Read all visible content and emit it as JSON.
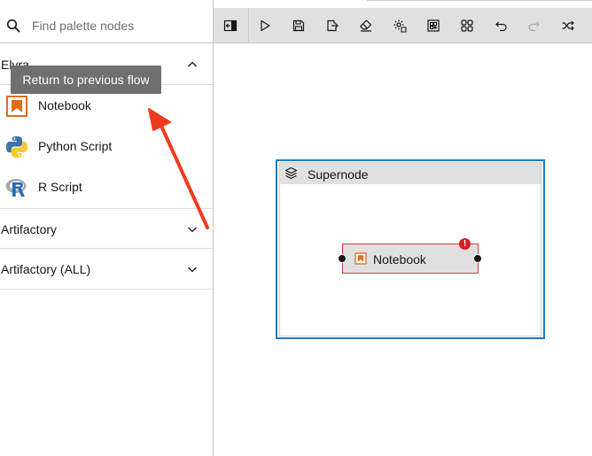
{
  "palette": {
    "search": {
      "placeholder": "Find palette nodes"
    },
    "categories": [
      {
        "label": "Elyra",
        "expanded": true,
        "nodes": [
          {
            "label": "Notebook",
            "icon": "notebook-icon"
          },
          {
            "label": "Python Script",
            "icon": "python-icon"
          },
          {
            "label": "R Script",
            "icon": "r-icon"
          }
        ]
      },
      {
        "label": "Artifactory",
        "expanded": false
      },
      {
        "label": "Artifactory (ALL)",
        "expanded": false
      }
    ]
  },
  "tooltip": {
    "text": "Return to previous flow"
  },
  "toolbar": {
    "buttons": [
      {
        "name": "return-to-previous-flow",
        "icon": "return-icon"
      },
      {
        "name": "run-pipeline",
        "icon": "play-icon"
      },
      {
        "name": "save-pipeline",
        "icon": "save-icon"
      },
      {
        "name": "export-pipeline",
        "icon": "export-icon"
      },
      {
        "name": "clear-pipeline",
        "icon": "eraser-icon"
      },
      {
        "name": "pipeline-properties",
        "icon": "settings-icon"
      },
      {
        "name": "open-runtimes",
        "icon": "runtimes-icon"
      },
      {
        "name": "open-component-catalogs",
        "icon": "catalog-icon"
      },
      {
        "name": "undo",
        "icon": "undo-icon"
      },
      {
        "name": "redo",
        "icon": "redo-icon"
      },
      {
        "name": "arrange",
        "icon": "arrange-icon"
      }
    ]
  },
  "canvas": {
    "supernode": {
      "title": "Supernode"
    },
    "node": {
      "label": "Notebook",
      "error_badge": "!"
    }
  },
  "colors": {
    "accent": "#1e7ac4",
    "error": "#da1e28",
    "notebook_orange": "#e06b1a",
    "annotation_arrow": "#f03a1e"
  }
}
